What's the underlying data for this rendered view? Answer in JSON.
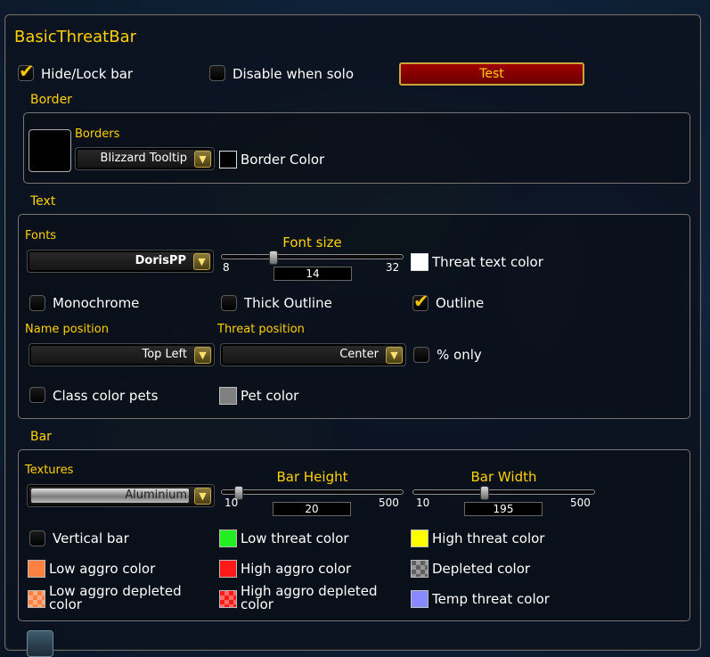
{
  "window": {
    "title": "BasicThreatBar"
  },
  "top": {
    "hide_lock_label": "Hide/Lock bar",
    "disable_solo_label": "Disable when solo",
    "test_label": "Test"
  },
  "border": {
    "section": "Border",
    "borders_label": "Borders",
    "borders_value": "Blizzard Tooltip",
    "border_color_label": "Border Color"
  },
  "text": {
    "section": "Text",
    "fonts_label": "Fonts",
    "font_value": "DorisPP",
    "font_size": {
      "title": "Font size",
      "min": "8",
      "max": "32",
      "value": "14"
    },
    "threat_text_color_label": "Threat text color",
    "monochrome_label": "Monochrome",
    "thick_outline_label": "Thick Outline",
    "outline_label": "Outline",
    "name_position_label": "Name position",
    "name_position_value": "Top Left",
    "threat_position_label": "Threat position",
    "threat_position_value": "Center",
    "percent_only_label": "% only",
    "class_color_pets_label": "Class color pets",
    "pet_color_label": "Pet color"
  },
  "bar": {
    "section": "Bar",
    "textures_label": "Textures",
    "texture_value": "Aluminium",
    "bar_height": {
      "title": "Bar Height",
      "min": "10",
      "max": "500",
      "value": "20"
    },
    "bar_width": {
      "title": "Bar Width",
      "min": "10",
      "max": "500",
      "value": "195"
    },
    "vertical_bar_label": "Vertical bar",
    "low_threat_color_label": "Low threat color",
    "high_threat_color_label": "High threat color",
    "low_aggro_color_label": "Low aggro color",
    "high_aggro_color_label": "High aggro color",
    "depleted_color_label": "Depleted color",
    "low_aggro_depleted_label_1": "Low aggro depleted",
    "low_aggro_depleted_label_2": "color",
    "high_aggro_depleted_label_1": "High aggro depleted",
    "high_aggro_depleted_label_2": "color",
    "temp_threat_color_label": "Temp threat color"
  },
  "colors": {
    "gold": "#ffd200",
    "low_threat": "#22ee22",
    "high_threat": "#ffff00",
    "low_aggro": "#ff8040",
    "high_aggro": "#ff1a1a",
    "depleted": "#606060",
    "temp_threat": "#8888ff",
    "pet": "#808080",
    "threat_text": "#ffffff",
    "border_color": "#000000"
  },
  "icons": [
    "checkmark-icon",
    "dropdown-arrow-icon",
    "addon-logo-icon"
  ]
}
